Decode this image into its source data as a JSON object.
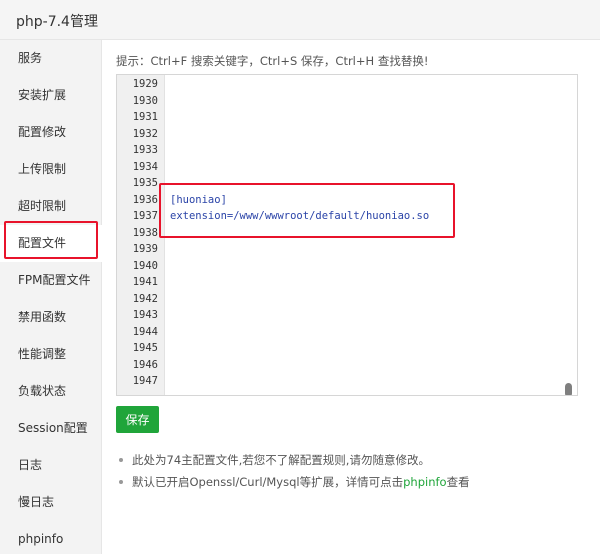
{
  "window": {
    "title": "php-7.4管理"
  },
  "sidebar": {
    "items": [
      {
        "label": "服务"
      },
      {
        "label": "安装扩展"
      },
      {
        "label": "配置修改"
      },
      {
        "label": "上传限制"
      },
      {
        "label": "超时限制"
      },
      {
        "label": "配置文件"
      },
      {
        "label": "FPM配置文件"
      },
      {
        "label": "禁用函数"
      },
      {
        "label": "性能调整"
      },
      {
        "label": "负载状态"
      },
      {
        "label": "Session配置"
      },
      {
        "label": "日志"
      },
      {
        "label": "慢日志"
      },
      {
        "label": "phpinfo"
      }
    ],
    "active_label": "配置文件"
  },
  "main": {
    "tip": "提示：Ctrl+F 搜索关键字，Ctrl+S 保存，Ctrl+H 查找替换!",
    "editor": {
      "line_numbers": [
        "1929",
        "1930",
        "1931",
        "1932",
        "1933",
        "1934",
        "1935",
        "1936",
        "1937",
        "1938",
        "1939",
        "1940",
        "1941",
        "1942",
        "1943",
        "1944",
        "1945",
        "1946",
        "1947"
      ],
      "lines": {
        "1936": "[huoniao]",
        "1937": "extension=/www/wwwroot/default/huoniao.so"
      }
    },
    "save_label": "保存",
    "notes": {
      "note1": "此处为74主配置文件,若您不了解配置规则,请勿随意修改。",
      "note2_prefix": "默认已开启Openssl/Curl/Mysql等扩展，详情可点击",
      "note2_link": "phpinfo",
      "note2_suffix": "查看"
    }
  },
  "colors": {
    "accent": "#20a53a",
    "highlight": "#e8132b",
    "code_text": "#2b44a8"
  }
}
